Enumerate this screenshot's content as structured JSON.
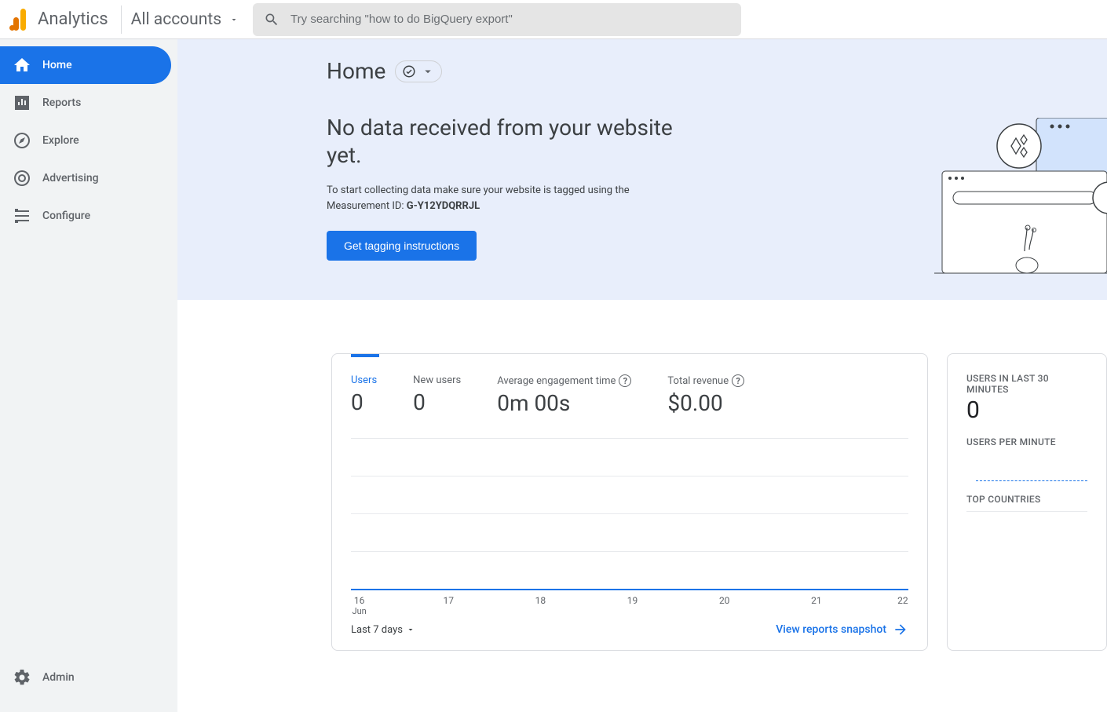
{
  "header": {
    "brand": "Analytics",
    "account_switcher": "All accounts",
    "search_placeholder": "Try searching \"how to do BigQuery export\""
  },
  "sidebar": {
    "items": [
      {
        "label": "Home"
      },
      {
        "label": "Reports"
      },
      {
        "label": "Explore"
      },
      {
        "label": "Advertising"
      },
      {
        "label": "Configure"
      }
    ],
    "admin": "Admin"
  },
  "banner": {
    "title": "Home",
    "heading": "No data received from your website yet.",
    "text_prefix": "To start collecting data make sure your website is tagged using the Measurement ID: ",
    "measurement_id": "G-Y12YDQRRJL",
    "button": "Get tagging instructions"
  },
  "card_main": {
    "metrics": [
      {
        "label": "Users",
        "value": "0"
      },
      {
        "label": "New users",
        "value": "0"
      },
      {
        "label": "Average engagement time",
        "value": "0m 00s",
        "help": true
      },
      {
        "label": "Total revenue",
        "value": "$0.00",
        "help": true
      }
    ],
    "date_range": "Last 7 days",
    "snapshot_link": "View reports snapshot"
  },
  "card_side": {
    "users_30_label": "USERS IN LAST 30 MINUTES",
    "users_30_value": "0",
    "users_per_min": "USERS PER MINUTE",
    "top_countries": "TOP COUNTRIES"
  },
  "chart_data": {
    "type": "line",
    "title": "",
    "xlabel": "",
    "ylabel": "",
    "categories": [
      "16 Jun",
      "17",
      "18",
      "19",
      "20",
      "21",
      "22"
    ],
    "series": [
      {
        "name": "Users",
        "values": [
          0,
          0,
          0,
          0,
          0,
          0,
          0
        ]
      }
    ],
    "ylim": [
      0,
      1
    ]
  }
}
